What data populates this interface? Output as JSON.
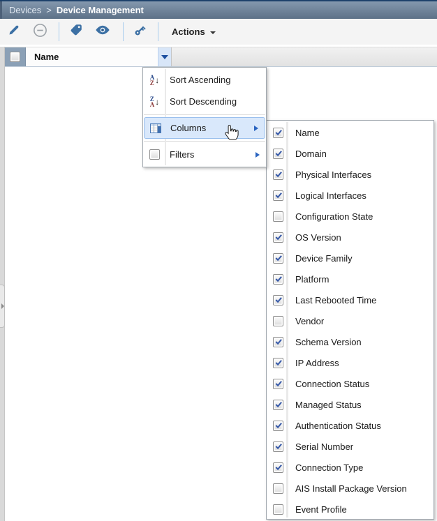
{
  "breadcrumb": {
    "parent": "Devices",
    "separator": ">",
    "current": "Device Management"
  },
  "toolbar": {
    "buttons": [
      {
        "icon": "edit-icon",
        "enabled": true
      },
      {
        "icon": "remove-icon",
        "enabled": false
      },
      {
        "icon": "tag-icon",
        "enabled": true
      },
      {
        "icon": "eye-icon",
        "enabled": true
      },
      {
        "icon": "key-icon",
        "enabled": true
      }
    ],
    "actions_label": "Actions"
  },
  "grid": {
    "column_header": "Name"
  },
  "header_menu": {
    "items": [
      {
        "label": "Sort Ascending",
        "icon": "sort-ascending-icon"
      },
      {
        "label": "Sort Descending",
        "icon": "sort-descending-icon"
      },
      {
        "label": "Columns",
        "icon": "columns-icon",
        "submenu": true,
        "highlighted": true
      },
      {
        "label": "Filters",
        "icon": "checkbox-icon",
        "submenu": true,
        "checked": false
      }
    ],
    "sort_asc_letters": {
      "top": "A",
      "bottom": "Z"
    },
    "sort_desc_letters": {
      "top": "Z",
      "bottom": "A"
    },
    "arrow_glyph": "↓"
  },
  "columns_submenu": {
    "items": [
      {
        "label": "Name",
        "checked": true
      },
      {
        "label": "Domain",
        "checked": true
      },
      {
        "label": "Physical Interfaces",
        "checked": true
      },
      {
        "label": "Logical Interfaces",
        "checked": true
      },
      {
        "label": "Configuration State",
        "checked": false
      },
      {
        "label": "OS Version",
        "checked": true
      },
      {
        "label": "Device Family",
        "checked": true
      },
      {
        "label": "Platform",
        "checked": true
      },
      {
        "label": "Last Rebooted Time",
        "checked": true
      },
      {
        "label": "Vendor",
        "checked": false
      },
      {
        "label": "Schema Version",
        "checked": true
      },
      {
        "label": "IP Address",
        "checked": true
      },
      {
        "label": "Connection Status",
        "checked": true
      },
      {
        "label": "Managed Status",
        "checked": true
      },
      {
        "label": "Authentication Status",
        "checked": true
      },
      {
        "label": "Serial Number",
        "checked": true
      },
      {
        "label": "Connection Type",
        "checked": true
      },
      {
        "label": "AIS Install Package Version",
        "checked": false
      },
      {
        "label": "Event Profile",
        "checked": false
      }
    ]
  },
  "colors": {
    "header_gradient_top": "#8498ae",
    "header_gradient_bottom": "#5d7187",
    "header_top_border": "#1e416b",
    "accent_blue": "#3c70a4",
    "toolbar_bg": "#f4f4f4",
    "toolbar_separator": "#a9cdee",
    "selection_cell_bg": "#8ba0b6",
    "trigger_bg": "#d8e6f8",
    "trigger_arrow": "#1c4fa0",
    "menu_highlight_bg": "#d9e8fb",
    "menu_highlight_border": "#99bfed",
    "submenu_arrow": "#2a64c0",
    "check_color": "#3558a8",
    "disabled_icon": "#9aa0a6"
  }
}
